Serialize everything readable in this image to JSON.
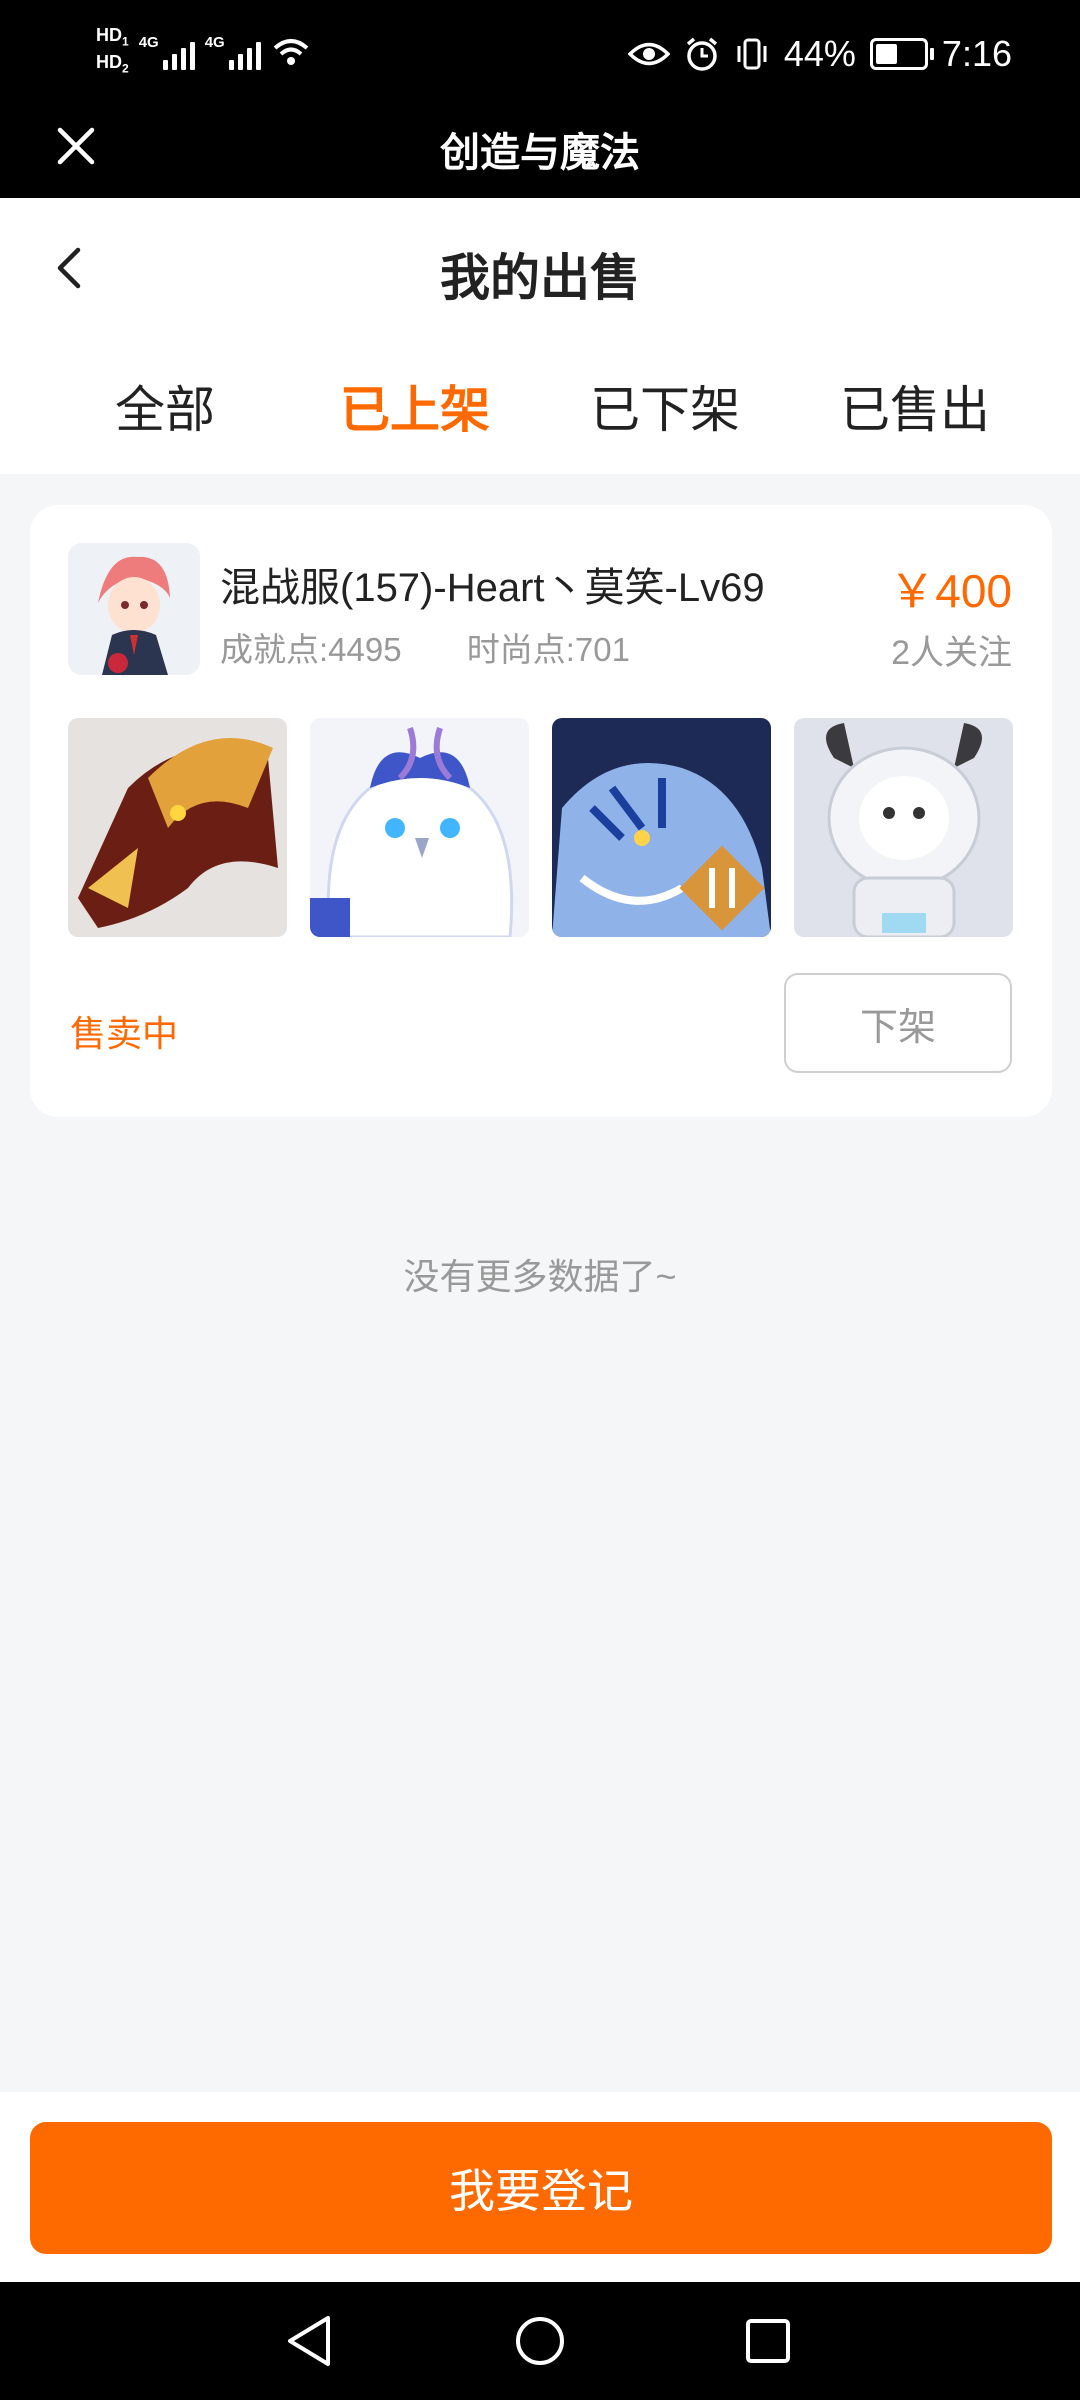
{
  "status_bar": {
    "hd1": "HD",
    "sim1": "1",
    "hd2": "HD",
    "sim2": "2",
    "net1": "4G",
    "net2": "4G",
    "battery": "44%",
    "time": "7:16"
  },
  "mini_program": {
    "title": "创造与魔法"
  },
  "page": {
    "title": "我的出售"
  },
  "tabs": [
    {
      "label": "全部",
      "active": false
    },
    {
      "label": "已上架",
      "active": true
    },
    {
      "label": "已下架",
      "active": false
    },
    {
      "label": "已售出",
      "active": false
    }
  ],
  "listing": {
    "title": "混战服(157)-Heart丶莫笑-Lv69",
    "achievement": "成就点:4495",
    "fashion": "时尚点:701",
    "price": "￥400",
    "followers": "2人关注",
    "status": "售卖中",
    "delist_label": "下架",
    "thumbnails": [
      "dragon-head",
      "snow-owl",
      "ice-tiger",
      "robot-bull"
    ]
  },
  "no_more": "没有更多数据了~",
  "actions": {
    "register_label": "我要登记"
  },
  "colors": {
    "accent": "#ff6a00",
    "background": "#f5f6f8",
    "muted": "#999999"
  }
}
